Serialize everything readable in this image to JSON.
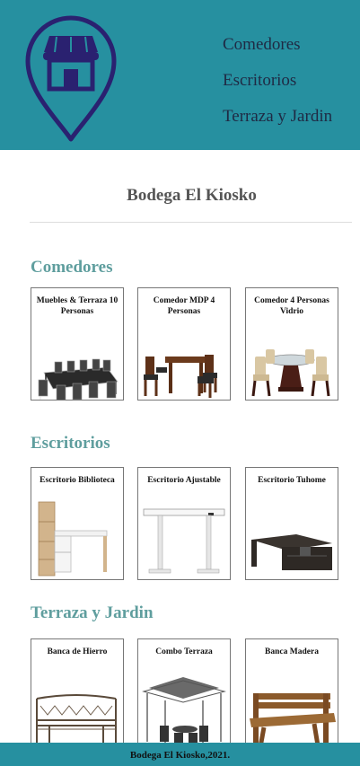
{
  "nav": [
    "Comedores",
    "Escritorios",
    "Terraza y Jardin"
  ],
  "brand": "Bodega El Kiosko",
  "sections": [
    {
      "title": "Comedores",
      "products": [
        "Muebles & Terraza 10 Personas",
        "Comedor MDP 4 Personas",
        "Comedor 4 Personas Vidrio"
      ]
    },
    {
      "title": "Escritorios",
      "products": [
        "Escritorio Biblioteca",
        "Escritorio Ajustable",
        "Escritorio Tuhome"
      ]
    },
    {
      "title": "Terraza y Jardin",
      "products": [
        "Banca de Hierro",
        "Combo Terraza",
        "Banca Madera"
      ]
    }
  ],
  "footer": "Bodega El Kiosko,2021.",
  "icons": {
    "logo": "store-location-pin-icon"
  },
  "colors": {
    "header": "#2690a0",
    "logo": "#2a2170",
    "section_title": "#5f9e9e"
  }
}
